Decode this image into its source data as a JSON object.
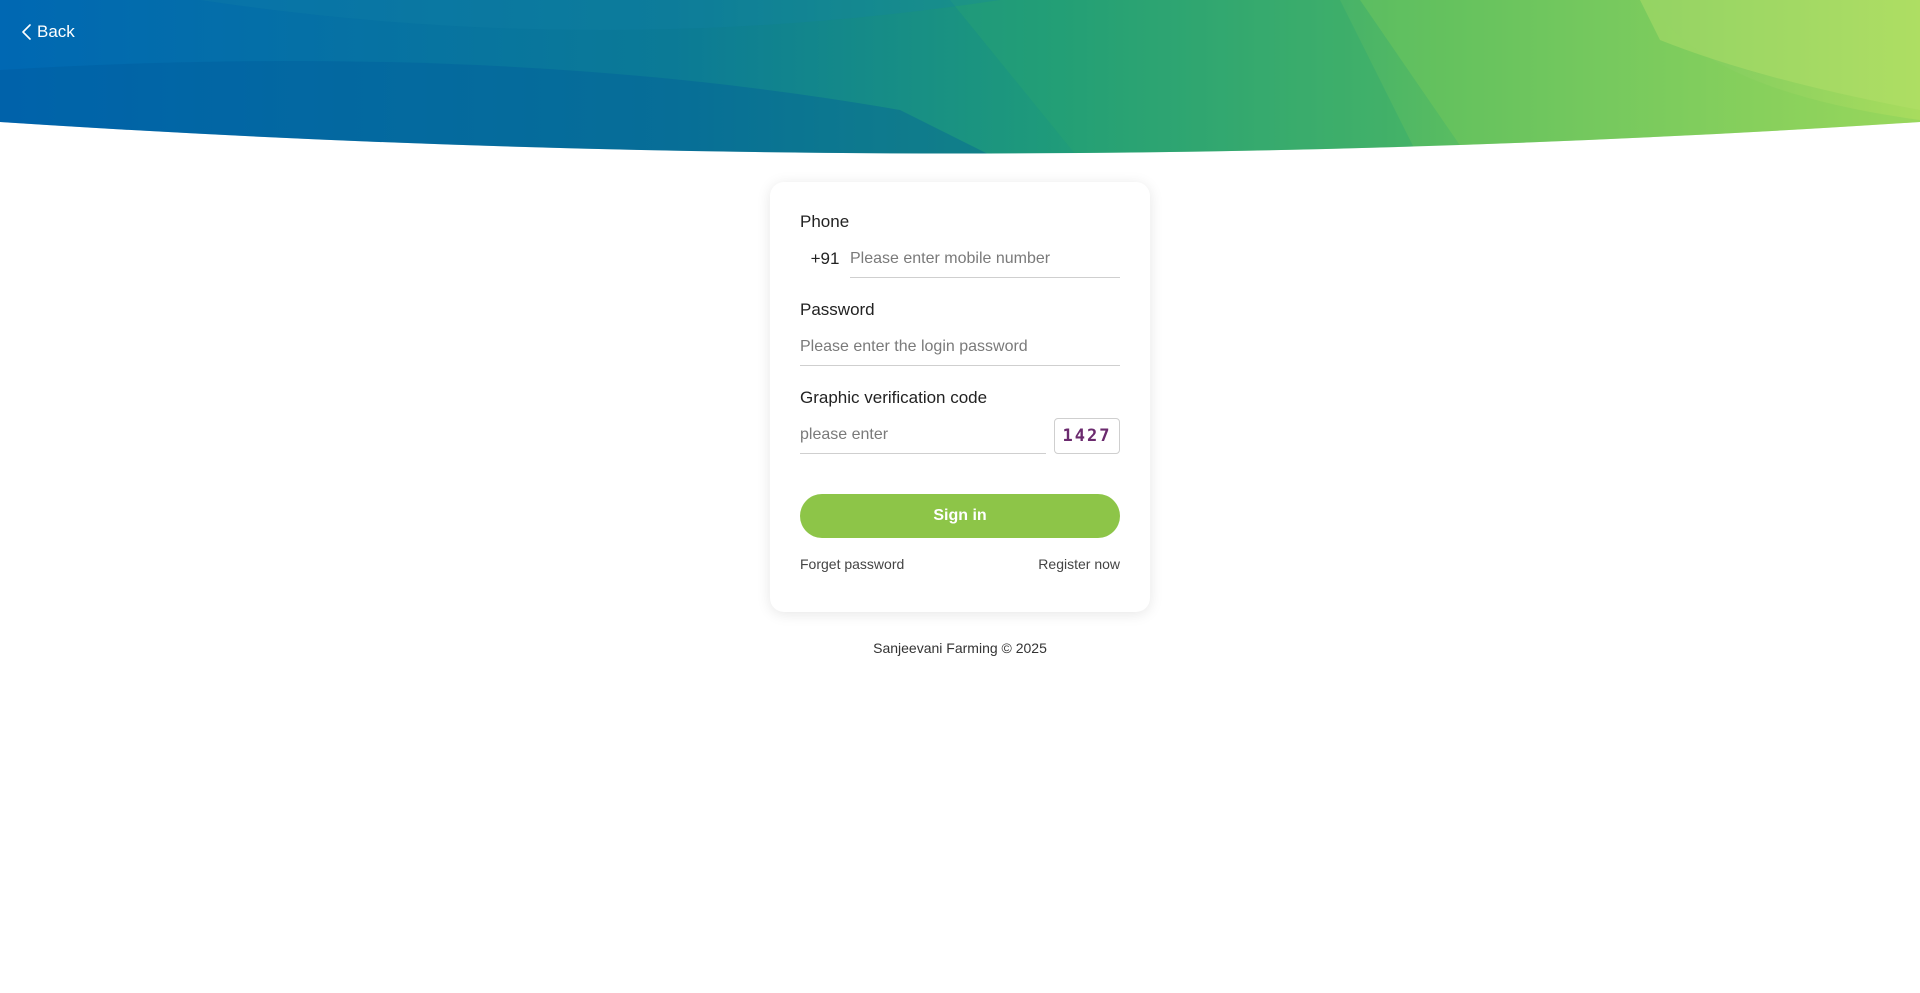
{
  "header": {
    "back_label": "Back"
  },
  "login_form": {
    "phone": {
      "label": "Phone",
      "country_code": "+91",
      "placeholder": "Please enter mobile number",
      "value": ""
    },
    "password": {
      "label": "Password",
      "placeholder": "Please enter the login password",
      "value": ""
    },
    "captcha": {
      "label": "Graphic verification code",
      "placeholder": "please enter",
      "value": "",
      "code": "1427",
      "code_color": "#6b2a6e"
    },
    "signin_label": "Sign in",
    "forget_password_label": "Forget password",
    "register_label": "Register now"
  },
  "footer": {
    "text": "Sanjeevani Farming © 2025"
  },
  "colors": {
    "accent": "#8dc548",
    "banner_start": "#0068b3",
    "banner_end": "#a8dc5e"
  },
  "icons": {
    "back": "chevron-left-icon"
  }
}
